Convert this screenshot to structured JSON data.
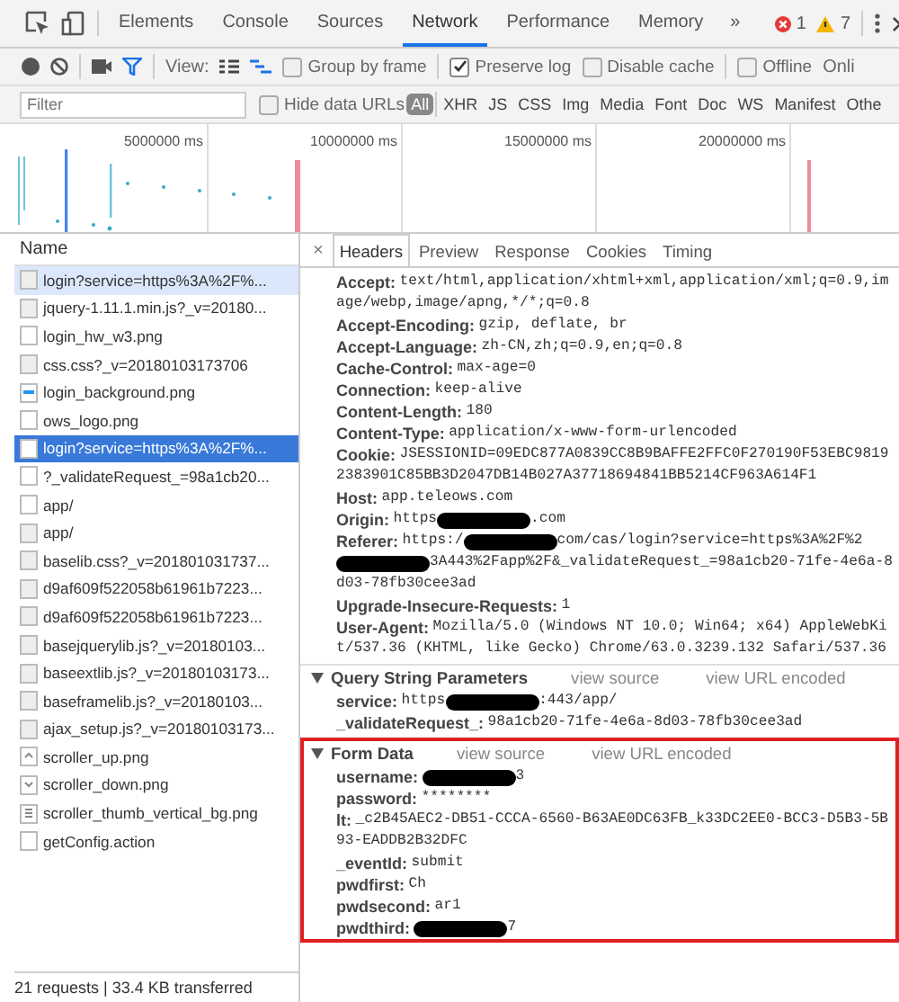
{
  "main_tabs": [
    {
      "label": "Elements",
      "selected": false
    },
    {
      "label": "Console",
      "selected": false
    },
    {
      "label": "Sources",
      "selected": false
    },
    {
      "label": "Network",
      "selected": true
    },
    {
      "label": "Performance",
      "selected": false
    },
    {
      "label": "Memory",
      "selected": false
    }
  ],
  "more_tabs": "»",
  "error_count": "1",
  "warning_count": "7",
  "toolbar": {
    "view_label": "View:",
    "checkboxes": [
      {
        "label": "Group by frame",
        "checked": false
      },
      {
        "label": "Preserve log",
        "checked": true
      },
      {
        "label": "Disable cache",
        "checked": false
      },
      {
        "label": "Offline",
        "checked": false
      }
    ],
    "online_cut": "Onli"
  },
  "filter": {
    "placeholder": "Filter",
    "hide_data_urls": {
      "label": "Hide data URLs",
      "checked": false
    },
    "types": [
      {
        "label": "All",
        "selected": true
      },
      {
        "label": "XHR",
        "selected": false
      },
      {
        "label": "JS",
        "selected": false
      },
      {
        "label": "CSS",
        "selected": false
      },
      {
        "label": "Img",
        "selected": false
      },
      {
        "label": "Media",
        "selected": false
      },
      {
        "label": "Font",
        "selected": false
      },
      {
        "label": "Doc",
        "selected": false
      },
      {
        "label": "WS",
        "selected": false
      },
      {
        "label": "Manifest",
        "selected": false
      },
      {
        "label": "Othe",
        "selected": false
      }
    ]
  },
  "timeline": {
    "ticks": [
      "5000000 ms",
      "10000000 ms",
      "15000000 ms",
      "20000000 ms"
    ]
  },
  "requests": {
    "column": "Name",
    "rows": [
      {
        "name": "login?service=https%3A%2F%...",
        "kind": "doc",
        "selected": false,
        "hovered": true
      },
      {
        "name": "jquery-1.11.1.min.js?_v=20180...",
        "kind": "doc",
        "selected": false,
        "hovered": false
      },
      {
        "name": "login_hw_w3.png",
        "kind": "blank",
        "selected": false,
        "hovered": false
      },
      {
        "name": "css.css?_v=20180103173706",
        "kind": "doc",
        "selected": false,
        "hovered": false
      },
      {
        "name": "login_background.png",
        "kind": "image",
        "selected": false,
        "hovered": false
      },
      {
        "name": "ows_logo.png",
        "kind": "blank",
        "selected": false,
        "hovered": false
      },
      {
        "name": "login?service=https%3A%2F%...",
        "kind": "blank",
        "selected": true,
        "hovered": false
      },
      {
        "name": "?_validateRequest_=98a1cb20...",
        "kind": "blank",
        "selected": false,
        "hovered": false
      },
      {
        "name": "app/",
        "kind": "blank",
        "selected": false,
        "hovered": false
      },
      {
        "name": "app/",
        "kind": "doc",
        "selected": false,
        "hovered": false
      },
      {
        "name": "baselib.css?_v=201801031737...",
        "kind": "doc",
        "selected": false,
        "hovered": false
      },
      {
        "name": "d9af609f522058b61961b7223...",
        "kind": "doc",
        "selected": false,
        "hovered": false
      },
      {
        "name": "d9af609f522058b61961b7223...",
        "kind": "doc",
        "selected": false,
        "hovered": false
      },
      {
        "name": "basejquerylib.js?_v=20180103...",
        "kind": "doc",
        "selected": false,
        "hovered": false
      },
      {
        "name": "baseextlib.js?_v=20180103173...",
        "kind": "doc",
        "selected": false,
        "hovered": false
      },
      {
        "name": "baseframelib.js?_v=20180103...",
        "kind": "doc",
        "selected": false,
        "hovered": false
      },
      {
        "name": "ajax_setup.js?_v=20180103173...",
        "kind": "doc",
        "selected": false,
        "hovered": false
      },
      {
        "name": "scroller_up.png",
        "kind": "up",
        "selected": false,
        "hovered": false
      },
      {
        "name": "scroller_down.png",
        "kind": "down",
        "selected": false,
        "hovered": false
      },
      {
        "name": "scroller_thumb_vertical_bg.png",
        "kind": "lines",
        "selected": false,
        "hovered": false
      },
      {
        "name": "getConfig.action",
        "kind": "blank",
        "selected": false,
        "hovered": false
      }
    ],
    "status": "21 requests | 33.4 KB transferred"
  },
  "detail": {
    "close": "×",
    "tabs": [
      {
        "label": "Headers",
        "selected": true
      },
      {
        "label": "Preview",
        "selected": false
      },
      {
        "label": "Response",
        "selected": false
      },
      {
        "label": "Cookies",
        "selected": false
      },
      {
        "label": "Timing",
        "selected": false
      }
    ],
    "headers": [
      {
        "key": "Accept:",
        "value": [
          {
            "kind": "text",
            "text": "text/html,application/xhtml+xml,application/xml;q=0.9,image/webp,image/apng,*/*;q=0.8"
          }
        ]
      },
      {
        "key": "Accept-Encoding:",
        "value": [
          {
            "kind": "text",
            "text": "gzip, deflate, br"
          }
        ]
      },
      {
        "key": "Accept-Language:",
        "value": [
          {
            "kind": "text",
            "text": "zh-CN,zh;q=0.9,en;q=0.8"
          }
        ]
      },
      {
        "key": "Cache-Control:",
        "value": [
          {
            "kind": "text",
            "text": "max-age=0"
          }
        ]
      },
      {
        "key": "Connection:",
        "value": [
          {
            "kind": "text",
            "text": "keep-alive"
          }
        ]
      },
      {
        "key": "Content-Length:",
        "value": [
          {
            "kind": "text",
            "text": "180"
          }
        ]
      },
      {
        "key": "Content-Type:",
        "value": [
          {
            "kind": "text",
            "text": "application/x-www-form-urlencoded"
          }
        ]
      },
      {
        "key": "Cookie:",
        "value": [
          {
            "kind": "text",
            "text": "JSESSIONID=09EDC877A0839CC8B9BAFFE2FFC0F270190F53EBC98192383901C85BB3D2047DB14B027A37718694841BB5214CF963A614F1"
          }
        ]
      },
      {
        "key": "Host:",
        "value": [
          {
            "kind": "text",
            "text": "app.teleows.com"
          }
        ]
      },
      {
        "key": "Origin:",
        "value": [
          {
            "kind": "text",
            "text": "https"
          },
          {
            "kind": "redacted"
          },
          {
            "kind": "text",
            "text": ".com"
          }
        ]
      },
      {
        "key": "Referer:",
        "value": [
          {
            "kind": "text",
            "text": "https:/"
          },
          {
            "kind": "redacted"
          },
          {
            "kind": "text",
            "text": "com/cas/login?service=https%3A%2F%2"
          },
          {
            "kind": "redacted"
          },
          {
            "kind": "text",
            "text": "3A443%2Fapp%2F&_validateRequest_=98a1cb20-71fe-4e6a-8d03-78fb30cee3ad"
          }
        ]
      },
      {
        "key": "Upgrade-Insecure-Requests:",
        "value": [
          {
            "kind": "text",
            "text": "1"
          }
        ]
      },
      {
        "key": "User-Agent:",
        "value": [
          {
            "kind": "text",
            "text": "Mozilla/5.0 (Windows NT 10.0; Win64; x64) AppleWebKit/537.36 (KHTML, like Gecko) Chrome/63.0.3239.132 Safari/537.36"
          }
        ]
      }
    ],
    "query": {
      "title": "Query String Parameters",
      "expanded": true,
      "links": [
        "view source",
        "view URL encoded"
      ],
      "params": [
        {
          "key": "service:",
          "value": [
            {
              "kind": "text",
              "text": "https"
            },
            {
              "kind": "redacted"
            },
            {
              "kind": "text",
              "text": ":443/app/"
            }
          ]
        },
        {
          "key": "_validateRequest_:",
          "value": [
            {
              "kind": "text",
              "text": "98a1cb20-71fe-4e6a-8d03-78fb30cee3ad"
            }
          ]
        }
      ]
    },
    "form": {
      "title": "Form Data",
      "expanded": true,
      "links": [
        "view source",
        "view URL encoded"
      ],
      "params": [
        {
          "key": "username:",
          "value": [
            {
              "kind": "redacted"
            },
            {
              "kind": "text",
              "text": "3"
            }
          ]
        },
        {
          "key": "password:",
          "value": [
            {
              "kind": "text",
              "text": "********"
            }
          ]
        },
        {
          "key": "lt:",
          "value": [
            {
              "kind": "text",
              "text": "_c2B45AEC2-DB51-CCCA-6560-B63AE0DC63FB_k33DC2EE0-BCC3-D5B3-5B93-EADDB2B32DFC"
            }
          ]
        },
        {
          "key": "_eventId:",
          "value": [
            {
              "kind": "text",
              "text": "submit"
            }
          ]
        },
        {
          "key": "pwdfirst:",
          "value": [
            {
              "kind": "text",
              "text": "Ch"
            }
          ]
        },
        {
          "key": "pwdsecond:",
          "value": [
            {
              "kind": "text",
              "text": "ar1"
            }
          ]
        },
        {
          "key": "pwdthird:",
          "value": [
            {
              "kind": "redacted"
            },
            {
              "kind": "text",
              "text": "7"
            }
          ]
        }
      ]
    }
  }
}
